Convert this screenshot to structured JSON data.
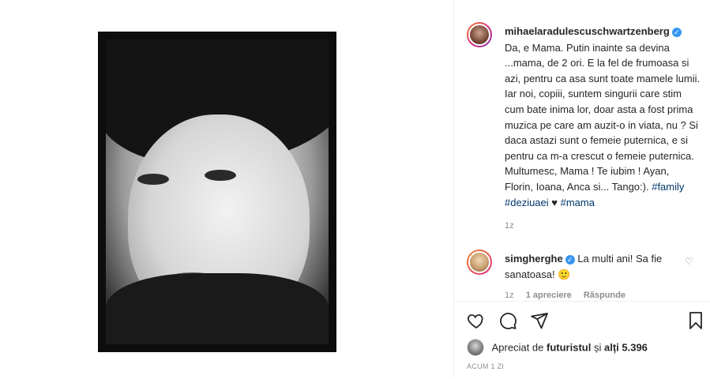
{
  "post": {
    "author": "mihaelaradulescuschwartzenberg",
    "caption": "Da, e Mama. Putin inainte sa devina ...mama, de 2 ori. E la fel de frumoasa si azi, pentru ca asa sunt toate mamele lumii. Iar noi, copiii, suntem singurii care stim cum bate inima lor, doar asta a fost prima muzica pe care am auzit-o in viata, nu ? Si daca astazi sunt o femeie puternica, e si pentru ca m-a crescut o femeie puternica. Multumesc, Mama ! Te iubim ! Ayan, Florin, Ioana, Anca si... Tango:).",
    "hashtag_1": "#family",
    "hashtag_2": "#deziuaei",
    "heart": "♥",
    "hashtag_3": "#mama",
    "time_ago": "1z"
  },
  "comment": {
    "author": "simgherghe",
    "text": "La multi ani! Sa fie sanatoasa!",
    "emoji": "🙂",
    "time": "1z",
    "likes": "1 apreciere",
    "reply": "Răspunde"
  },
  "likes": {
    "prefix": "Apreciat de",
    "user": "futuristul",
    "middle": "și",
    "others": "alți 5.396"
  },
  "date": "ACUM 1 ZI",
  "icons": {
    "like": "heart-icon",
    "comment": "comment-icon",
    "share": "share-icon",
    "save": "bookmark-icon"
  }
}
